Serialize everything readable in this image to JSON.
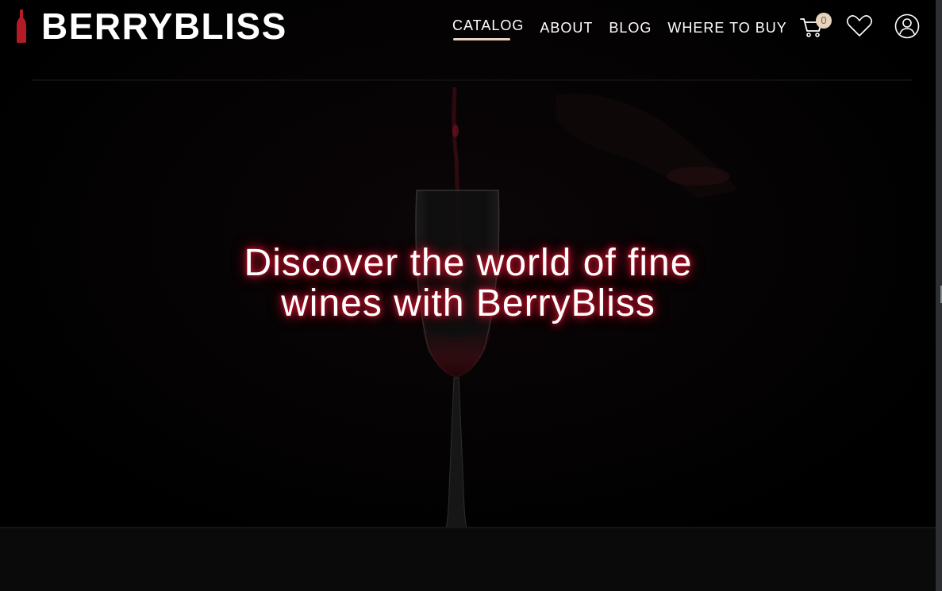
{
  "brand": {
    "name": "BERRYBLISS",
    "accent_color": "#b31b27",
    "badge_color": "#e8d4bd"
  },
  "nav": {
    "items": [
      {
        "label": "CATALOG",
        "active": true
      },
      {
        "label": "ABOUT",
        "active": false
      },
      {
        "label": "BLOG",
        "active": false
      },
      {
        "label": "WHERE TO BUY",
        "active": false
      }
    ]
  },
  "header_icons": {
    "cart": {
      "icon": "cart-icon",
      "count": "0"
    },
    "wishlist": {
      "icon": "heart-icon"
    },
    "account": {
      "icon": "user-icon"
    }
  },
  "hero": {
    "title": "Discover the world of fine wines with BerryBliss",
    "background": "dark photo of a wine glass being filled with red wine"
  }
}
